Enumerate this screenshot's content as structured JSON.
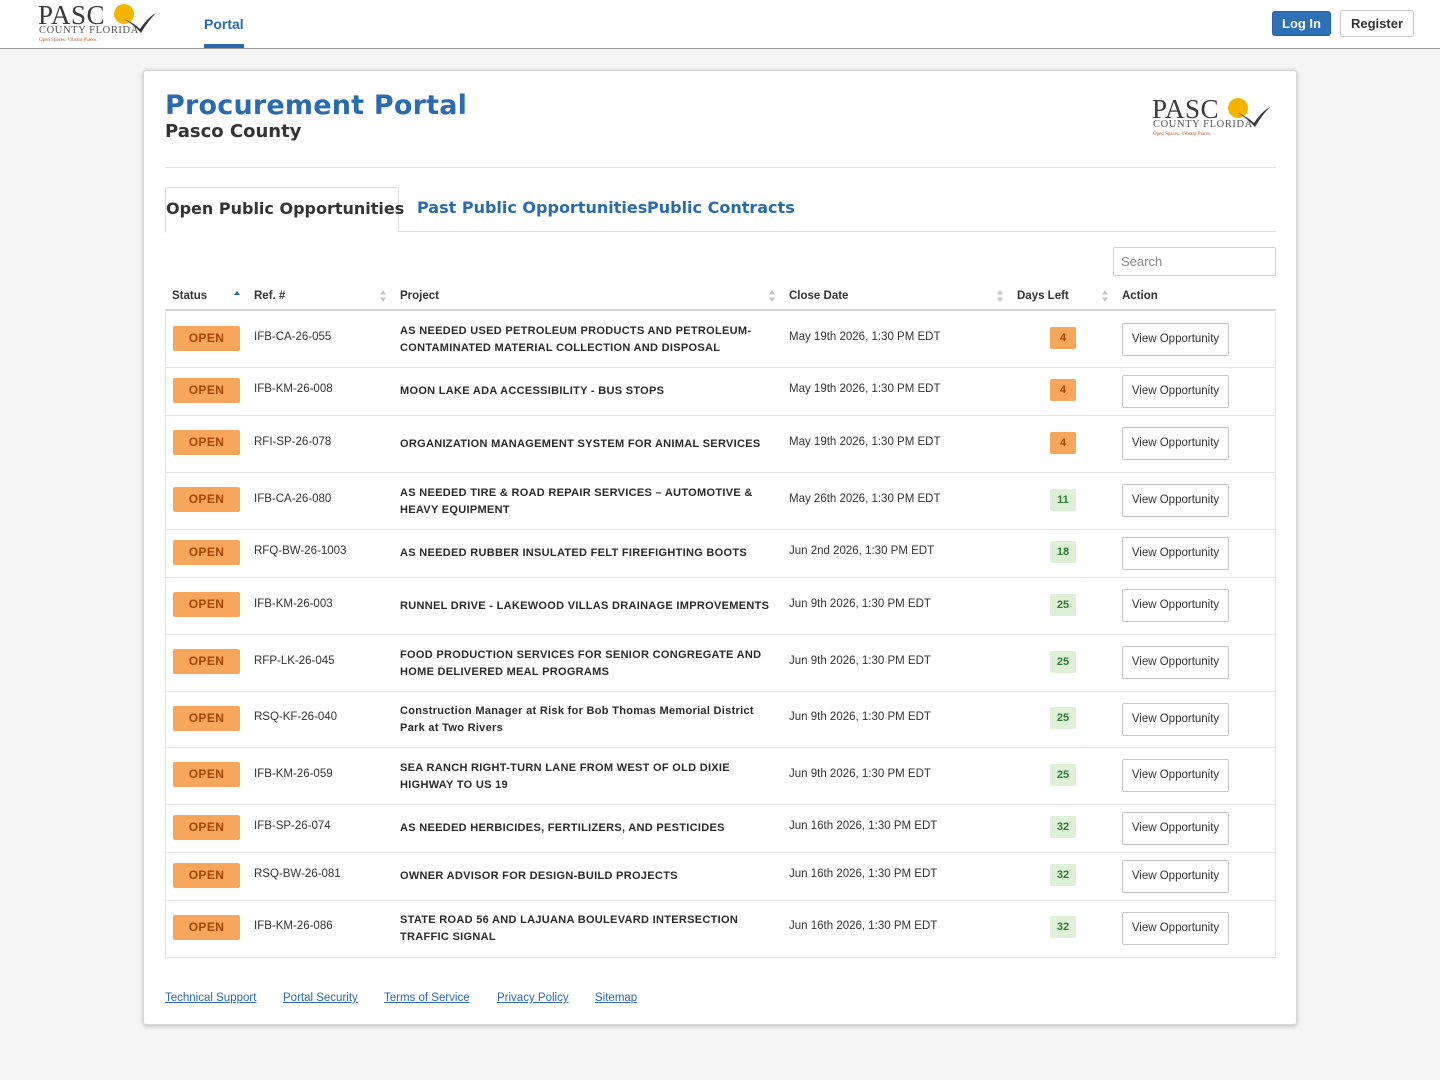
{
  "brand": {
    "logo_word": "PASC",
    "logo_sub": "COUNTY FLORIDA",
    "logo_tag": "Open Spaces. Vibrant Places."
  },
  "nav": {
    "portal_label": "Portal",
    "login_label": "Log In",
    "register_label": "Register"
  },
  "header": {
    "title": "Procurement Portal",
    "subtitle": "Pasco County"
  },
  "tabs": [
    {
      "label": "Open Public Opportunities",
      "active": true
    },
    {
      "label": "Past Public Opportunities",
      "active": false
    },
    {
      "label": "Public Contracts",
      "active": false
    }
  ],
  "search": {
    "placeholder": "Search"
  },
  "table": {
    "columns": [
      "Status",
      "Ref. #",
      "Project",
      "Close Date",
      "Days Left",
      "Action"
    ],
    "rows": [
      {
        "status": "OPEN",
        "ref": "IFB-CA-26-055",
        "project": "AS NEEDED USED PETROLEUM PRODUCTS AND PETROLEUM-CONTAMINATED MATERIAL COLLECTION AND DISPOSAL",
        "close": "May 19th 2026, 1:30 PM EDT",
        "days": "4",
        "level": "warn",
        "action": "View Opportunity"
      },
      {
        "status": "OPEN",
        "ref": "IFB-KM-26-008",
        "project": "MOON LAKE ADA ACCESSIBILITY - BUS STOPS",
        "close": "May 19th 2026, 1:30 PM EDT",
        "days": "4",
        "level": "warn",
        "action": "View Opportunity"
      },
      {
        "status": "OPEN",
        "ref": "RFI-SP-26-078",
        "project": "ORGANIZATION MANAGEMENT SYSTEM FOR ANIMAL SERVICES",
        "close": "May 19th 2026, 1:30 PM EDT",
        "days": "4",
        "level": "warn",
        "action": "View Opportunity"
      },
      {
        "status": "OPEN",
        "ref": "IFB-CA-26-080",
        "project": "AS NEEDED TIRE & ROAD REPAIR SERVICES – AUTOMOTIVE & HEAVY EQUIPMENT",
        "close": "May 26th 2026, 1:30 PM EDT",
        "days": "11",
        "level": "ok",
        "action": "View Opportunity"
      },
      {
        "status": "OPEN",
        "ref": "RFQ-BW-26-1003",
        "project": "AS NEEDED RUBBER INSULATED FELT FIREFIGHTING BOOTS",
        "close": "Jun 2nd 2026, 1:30 PM EDT",
        "days": "18",
        "level": "ok",
        "action": "View Opportunity"
      },
      {
        "status": "OPEN",
        "ref": "IFB-KM-26-003",
        "project": "RUNNEL DRIVE - LAKEWOOD VILLAS DRAINAGE IMPROVEMENTS",
        "close": "Jun 9th 2026, 1:30 PM EDT",
        "days": "25",
        "level": "ok",
        "action": "View Opportunity"
      },
      {
        "status": "OPEN",
        "ref": "RFP-LK-26-045",
        "project": "FOOD PRODUCTION SERVICES FOR SENIOR CONGREGATE AND HOME DELIVERED MEAL PROGRAMS",
        "close": "Jun 9th 2026, 1:30 PM EDT",
        "days": "25",
        "level": "ok",
        "action": "View Opportunity"
      },
      {
        "status": "OPEN",
        "ref": "RSQ-KF-26-040",
        "project": "Construction Manager at Risk for Bob Thomas Memorial District Park at Two Rivers",
        "close": "Jun 9th 2026, 1:30 PM EDT",
        "days": "25",
        "level": "ok",
        "action": "View Opportunity"
      },
      {
        "status": "OPEN",
        "ref": "IFB-KM-26-059",
        "project": "SEA RANCH RIGHT-TURN LANE FROM WEST OF OLD DIXIE HIGHWAY TO US 19",
        "close": "Jun 9th 2026, 1:30 PM EDT",
        "days": "25",
        "level": "ok",
        "action": "View Opportunity"
      },
      {
        "status": "OPEN",
        "ref": "IFB-SP-26-074",
        "project": "AS NEEDED HERBICIDES, FERTILIZERS, AND PESTICIDES",
        "close": "Jun 16th 2026, 1:30 PM EDT",
        "days": "32",
        "level": "ok",
        "action": "View Opportunity"
      },
      {
        "status": "OPEN",
        "ref": "RSQ-BW-26-081",
        "project": "OWNER ADVISOR FOR DESIGN-BUILD PROJECTS",
        "close": "Jun 16th 2026, 1:30 PM EDT",
        "days": "32",
        "level": "ok",
        "action": "View Opportunity"
      },
      {
        "status": "OPEN",
        "ref": "IFB-KM-26-086",
        "project": "STATE ROAD 56 AND LAJUANA BOULEVARD INTERSECTION TRAFFIC SIGNAL",
        "close": "Jun 16th 2026, 1:30 PM EDT",
        "days": "32",
        "level": "ok",
        "action": "View Opportunity"
      }
    ]
  },
  "footer": {
    "links": [
      "Technical Support",
      "Portal Security",
      "Terms of Service",
      "Privacy Policy",
      "Sitemap"
    ]
  },
  "colors": {
    "brand_blue": "#2a6aaf",
    "open_badge": "#f8a65b",
    "days_warn": "#f8a65b",
    "days_ok": "#dff0d8"
  }
}
